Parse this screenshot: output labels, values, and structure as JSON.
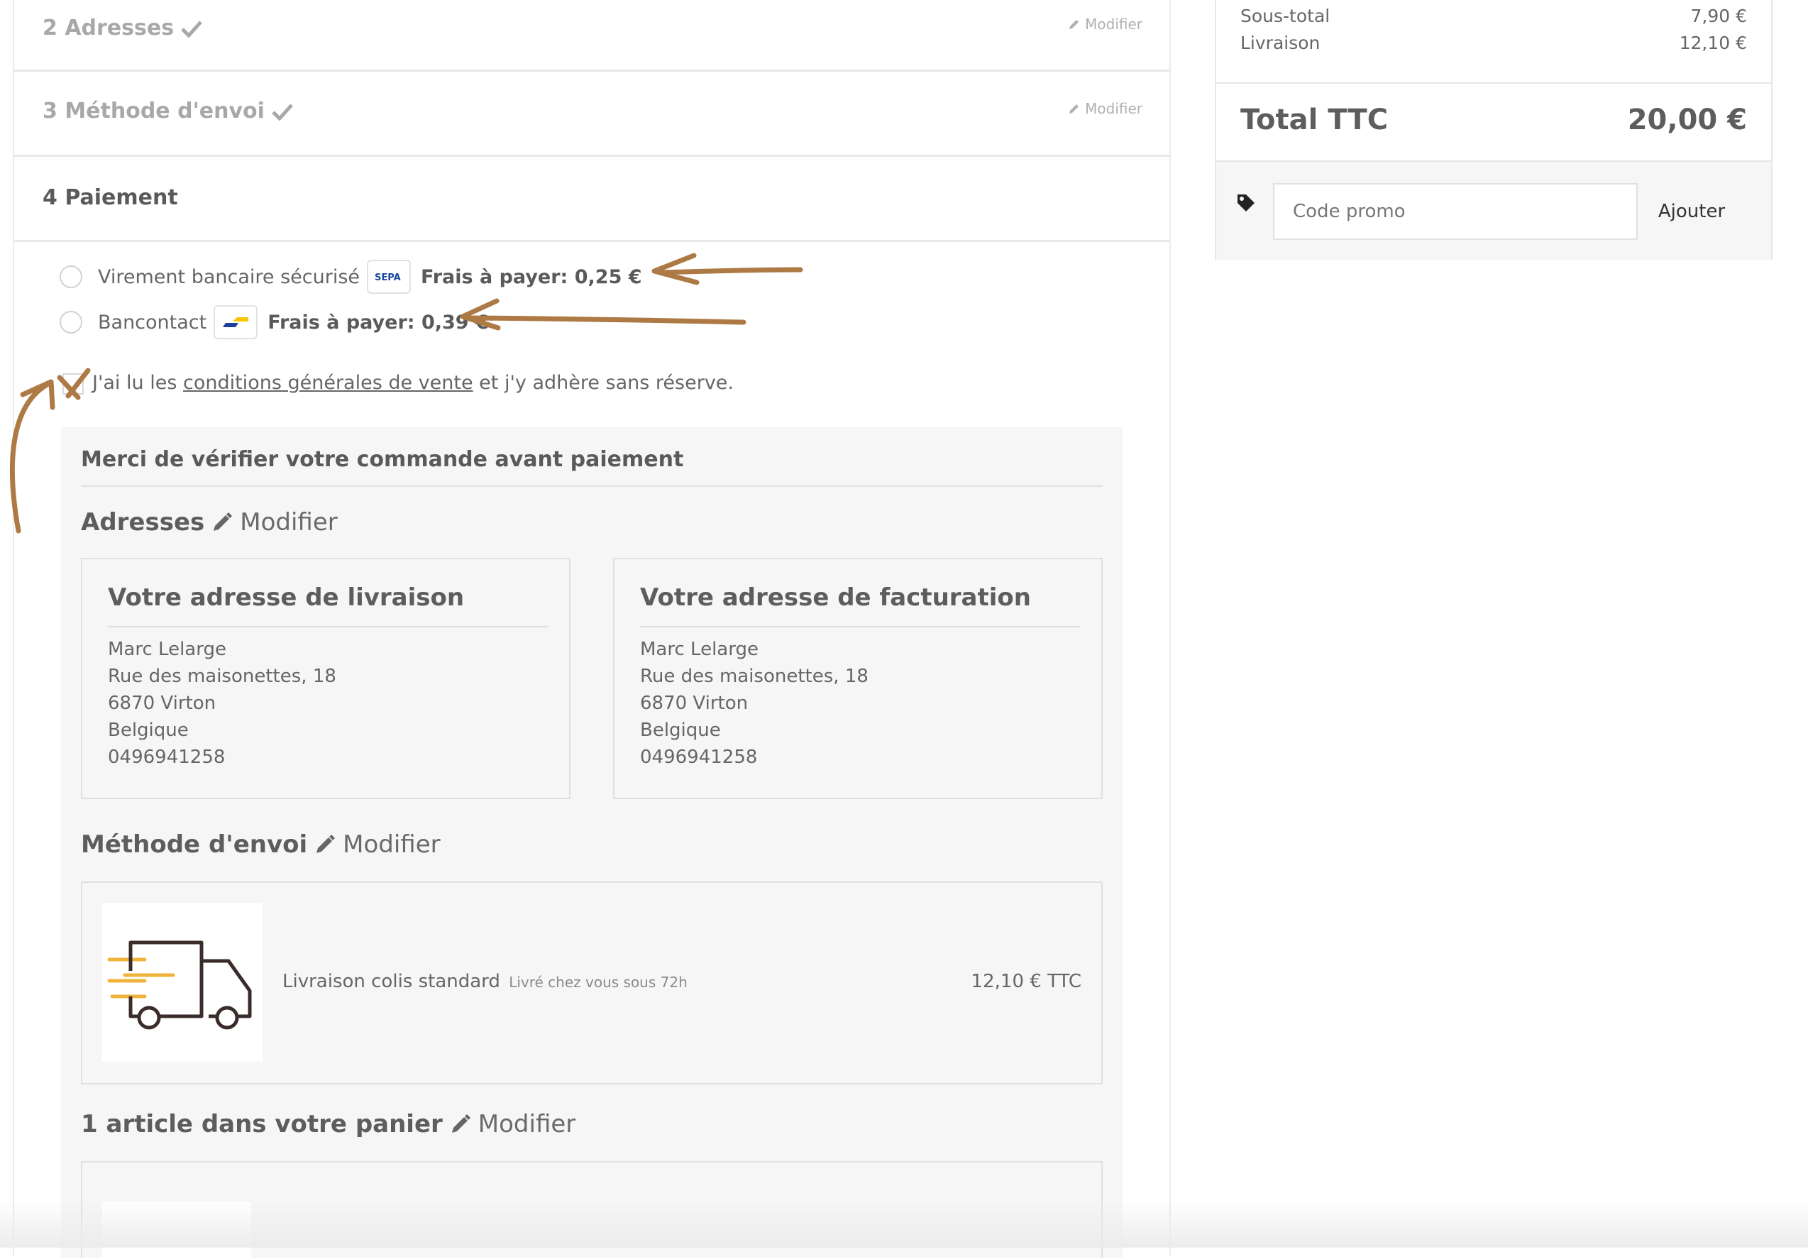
{
  "steps": {
    "addresses": {
      "title": "2 Adresses",
      "edit": "Modifier"
    },
    "shipping": {
      "title": "3 Méthode d'envoi",
      "edit": "Modifier"
    },
    "payment": {
      "title": "4 Paiement"
    }
  },
  "payment_options": [
    {
      "label": "Virement bancaire sécurisé",
      "logo": "sepa-logo",
      "logo_text": "SEPA",
      "fee": "Frais à payer: 0,25 €"
    },
    {
      "label": "Bancontact",
      "logo": "bancontact-logo",
      "fee": "Frais à payer: 0,39 €"
    }
  ],
  "terms": {
    "before": "J'ai lu les ",
    "link": "conditions générales de vente",
    "after": " et j'y adhère sans réserve."
  },
  "review": {
    "title": "Merci de vérifier votre commande avant paiement",
    "addresses_heading": "Adresses",
    "addresses_edit": "Modifier",
    "delivery": {
      "title": "Votre adresse de livraison",
      "lines": [
        "Marc Lelarge",
        "Rue des maisonettes, 18",
        "6870 Virton",
        "Belgique",
        "0496941258"
      ]
    },
    "billing": {
      "title": "Votre adresse de facturation",
      "lines": [
        "Marc Lelarge",
        "Rue des maisonettes, 18",
        "6870 Virton",
        "Belgique",
        "0496941258"
      ]
    },
    "shipping_heading": "Méthode d'envoi",
    "shipping_edit": "Modifier",
    "carrier": {
      "name": "Livraison colis standard",
      "delay": "Livré chez vous sous 72h",
      "price": "12,10 € TTC"
    },
    "cart_heading": "1 article dans votre panier",
    "cart_edit": "Modifier"
  },
  "summary": {
    "subtotal_label": "Sous-total",
    "subtotal_value": "7,90 €",
    "shipping_label": "Livraison",
    "shipping_value": "12,10 €",
    "total_label": "Total TTC",
    "total_value": "20,00 €",
    "promo_placeholder": "Code promo",
    "promo_button": "Ajouter"
  },
  "colors": {
    "annotation": "#ad7a45",
    "truck_accent": "#f0b43c",
    "truck_outline": "#3a2c2a"
  }
}
